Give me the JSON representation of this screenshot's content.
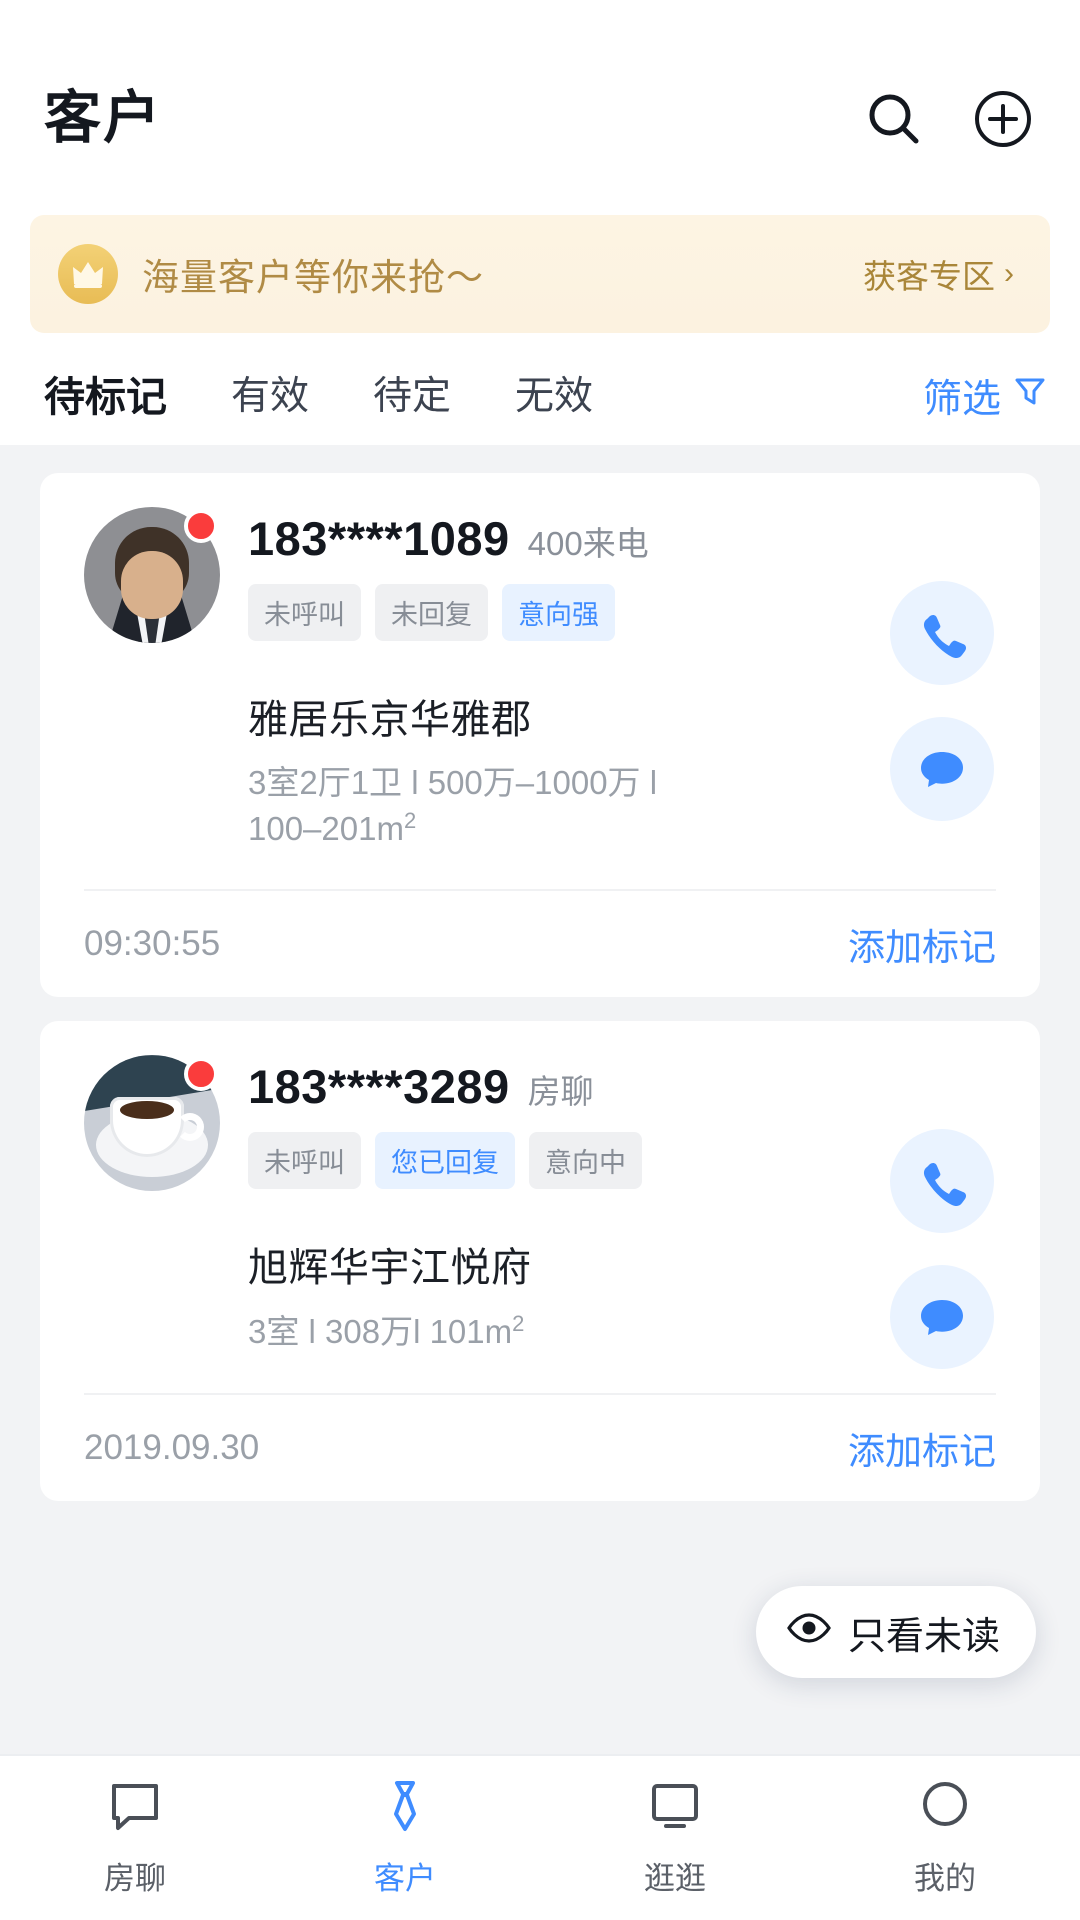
{
  "header": {
    "title": "客户",
    "search_icon": "search-icon",
    "add_icon": "plus-circle-icon"
  },
  "promo": {
    "icon": "crown-icon",
    "text": "海量客户等你来抢～",
    "link_label": "获客专区",
    "chevron": "›"
  },
  "tabs": {
    "items": [
      {
        "label": "待标记",
        "active": true
      },
      {
        "label": "有效",
        "active": false
      },
      {
        "label": "待定",
        "active": false
      },
      {
        "label": "无效",
        "active": false
      }
    ],
    "filter_label": "筛选",
    "filter_icon": "filter-funnel-icon"
  },
  "accent_color": "#3f8cff",
  "cards": [
    {
      "phone": "183****1089",
      "source": "400来电",
      "avatar": "person-avatar",
      "unread": true,
      "tags": [
        {
          "label": "未呼叫",
          "style": "gray"
        },
        {
          "label": "未回复",
          "style": "gray"
        },
        {
          "label": "意向强",
          "style": "blue"
        }
      ],
      "estate": "雅居乐京华雅郡",
      "specs_line1": "3室2厅1卫 l 500万–1000万 l",
      "specs_line2": "100–201m",
      "specs_unit": "2",
      "time": "09:30:55",
      "mark_label": "添加标记",
      "call_icon": "phone-icon",
      "chat_icon": "chat-bubble-icon"
    },
    {
      "phone": "183****3289",
      "source": "房聊",
      "avatar": "coffee-cup-avatar",
      "unread": true,
      "tags": [
        {
          "label": "未呼叫",
          "style": "gray"
        },
        {
          "label": "您已回复",
          "style": "blue"
        },
        {
          "label": "意向中",
          "style": "gray"
        }
      ],
      "estate": "旭辉华宇江悦府",
      "specs_line1": "3室 l 308万l  101m",
      "specs_line2": "",
      "specs_unit": "2",
      "time": "2019.09.30",
      "mark_label": "添加标记",
      "call_icon": "phone-icon",
      "chat_icon": "chat-bubble-icon"
    }
  ],
  "unread_filter": {
    "label": "只看未读",
    "icon": "eye-icon"
  },
  "bottom_nav": {
    "items": [
      {
        "label": "房聊",
        "icon": "chat-square-icon",
        "active": false
      },
      {
        "label": "客户",
        "icon": "tie-icon",
        "active": true
      },
      {
        "label": "逛逛",
        "icon": "monitor-icon",
        "active": false
      },
      {
        "label": "我的",
        "icon": "person-circle-icon",
        "active": false
      }
    ]
  }
}
